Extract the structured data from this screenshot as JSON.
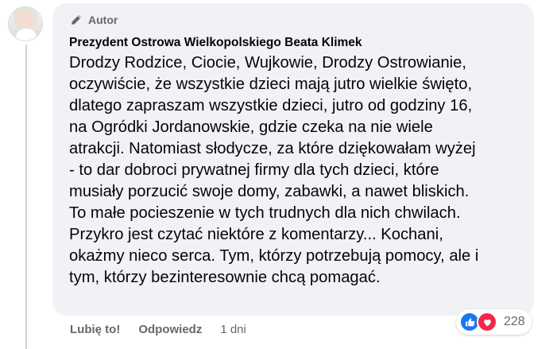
{
  "badge": {
    "label": "Autor"
  },
  "comment": {
    "author": "Prezydent Ostrowa Wielkopolskiego Beata Klimek",
    "lines": [
      "Drodzy Rodzice, Ciocie, Wujkowie, Drodzy Ostrowianie,",
      "oczywiście, że wszystkie dzieci mają jutro wielkie święto,",
      "dlatego zapraszam wszystkie dzieci, jutro od godziny 16,",
      "na Ogródki Jordanowskie, gdzie czeka na nie wiele",
      "atrakcji. Natomiast słodycze, za które dziękowałam wyżej",
      "- to dar dobroci prywatnej firmy dla tych dzieci, które",
      "musiały porzucić swoje domy, zabawki, a nawet bliskich.",
      "To małe pocieszenie w tych trudnych dla nich chwilach.",
      "Przykro jest czytać niektóre z komentarzy... Kochani,",
      "okażmy nieco serca. Tym, którzy potrzebują pomocy, ale i",
      "tym, którzy bezinteresownie chcą pomagać."
    ]
  },
  "actions": {
    "like": "Lubię to!",
    "reply": "Odpowiedz",
    "time": "1 dni"
  },
  "reactions": {
    "count": "228",
    "types": [
      "like-icon",
      "love-icon"
    ]
  },
  "colors": {
    "bubble": "#f0f2f5",
    "like": "#1877f2",
    "love": "#f02849",
    "muted": "#65676b"
  }
}
